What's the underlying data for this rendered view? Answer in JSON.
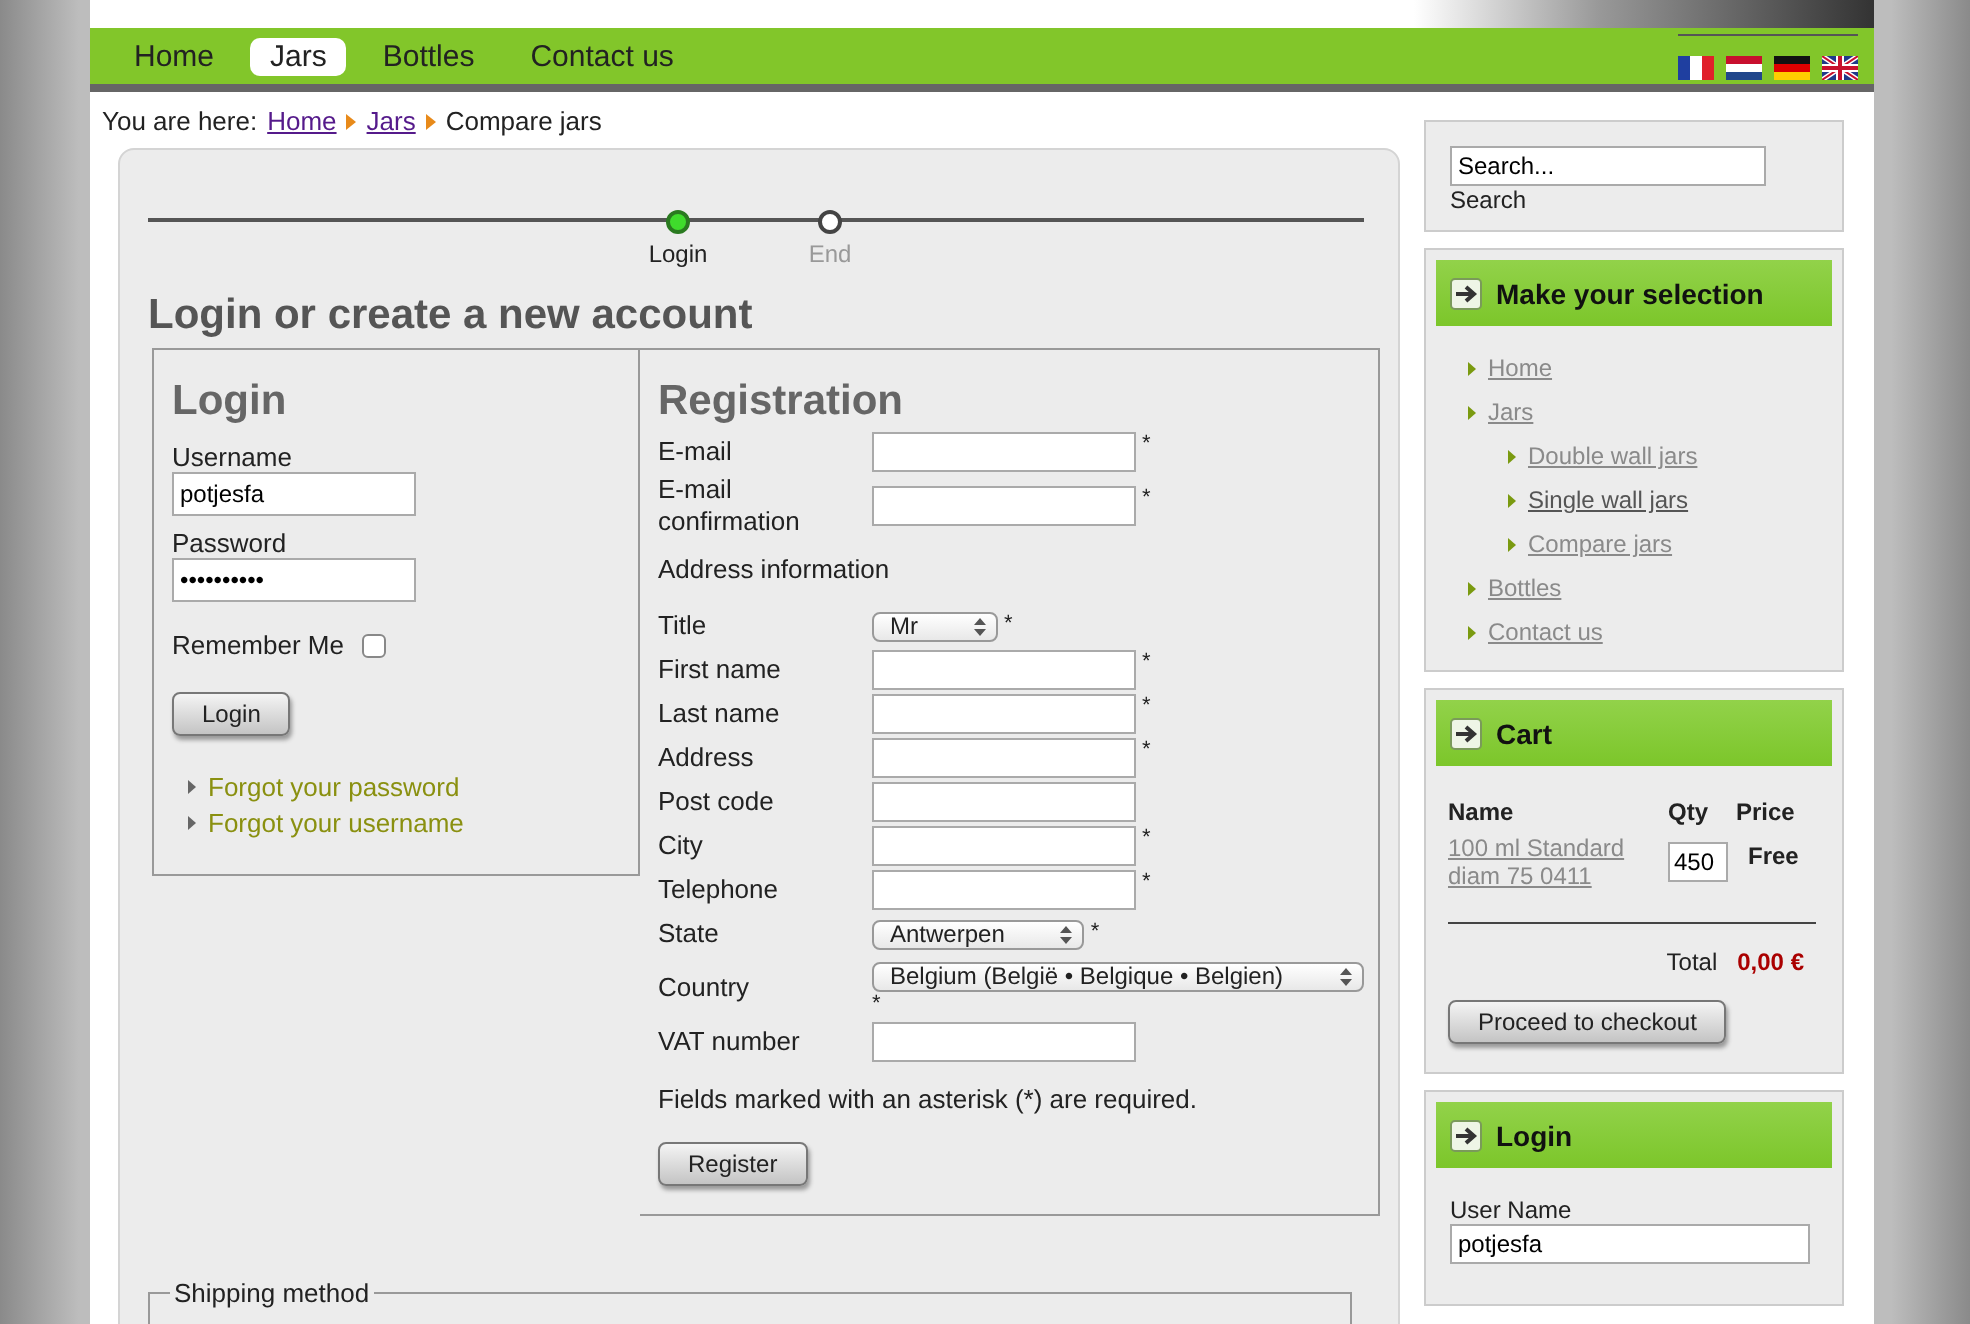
{
  "nav": [
    {
      "label": "Home",
      "selected": false
    },
    {
      "label": "Jars",
      "selected": true
    },
    {
      "label": "Bottles",
      "selected": false
    },
    {
      "label": "Contact us",
      "selected": false
    }
  ],
  "flags": [
    {
      "kind": "fr"
    },
    {
      "kind": "nl"
    },
    {
      "kind": "de"
    },
    {
      "kind": "gb"
    }
  ],
  "breadcrumb": {
    "prefix": "You are here:",
    "links": [
      "Home",
      "Jars"
    ],
    "current": "Compare jars"
  },
  "steps": [
    {
      "label": "Login",
      "selected": true
    },
    {
      "label": "End",
      "selected": false
    }
  ],
  "page_title": "Login or create a new account",
  "login": {
    "title": "Login",
    "username_label": "Username",
    "username": "potjesfa",
    "password_label": "Password",
    "password": "••••••••••",
    "remember_label": "Remember Me",
    "remember": false,
    "button": "Login",
    "links": [
      "Forgot your password",
      "Forgot your username"
    ]
  },
  "registration": {
    "title": "Registration",
    "fields": [
      {
        "kind": "text",
        "label": "E-mail",
        "mark": "*"
      },
      {
        "kind": "text",
        "label": "E-mail confirmation",
        "mark": "*"
      },
      {
        "kind": "heading",
        "label": "Address information"
      },
      {
        "kind": "select",
        "label": "Title",
        "value": "Mr",
        "mark": "*"
      },
      {
        "kind": "text",
        "label": "First name",
        "mark": "*"
      },
      {
        "kind": "text",
        "label": "Last name",
        "mark": "*"
      },
      {
        "kind": "text",
        "label": "Address",
        "mark": "*"
      },
      {
        "kind": "text",
        "label": "Post code"
      },
      {
        "kind": "text",
        "label": "City",
        "mark": "*"
      },
      {
        "kind": "text",
        "label": "Telephone",
        "mark": "*"
      },
      {
        "kind": "select",
        "label": "State",
        "value": "Antwerpen",
        "mark": "*"
      },
      {
        "kind": "wideselect",
        "label": "Country",
        "value": "Belgium (België • Belgique • Belgien)",
        "mark": "*"
      },
      {
        "kind": "text",
        "label": "VAT number"
      }
    ],
    "note": "Fields marked with an asterisk (*) are required.",
    "button": "Register"
  },
  "shipping": {
    "legend": "Shipping method"
  },
  "sidebar": {
    "search": {
      "value": "Search...",
      "label": "Search"
    },
    "menu": {
      "title": "Make your selection",
      "items": [
        {
          "label": "Home",
          "selected": false
        },
        {
          "label": "Jars",
          "selected": false,
          "children": [
            {
              "label": "Double wall jars",
              "selected": false
            },
            {
              "label": "Single wall jars",
              "selected": true
            },
            {
              "label": "Compare jars",
              "selected": false
            }
          ]
        },
        {
          "label": "Bottles",
          "selected": false
        },
        {
          "label": "Contact us",
          "selected": false
        }
      ]
    },
    "cart": {
      "title": "Cart",
      "columns": [
        "Name",
        "Qty",
        "Price"
      ],
      "rows": [
        {
          "name": "100 ml Standard diam 75 0411",
          "qty": "450",
          "price": "Free"
        }
      ],
      "total_label": "Total",
      "total": "0,00 €",
      "button": "Proceed to checkout"
    },
    "login": {
      "title": "Login",
      "user_label": "User Name",
      "user": "potjesfa"
    }
  }
}
